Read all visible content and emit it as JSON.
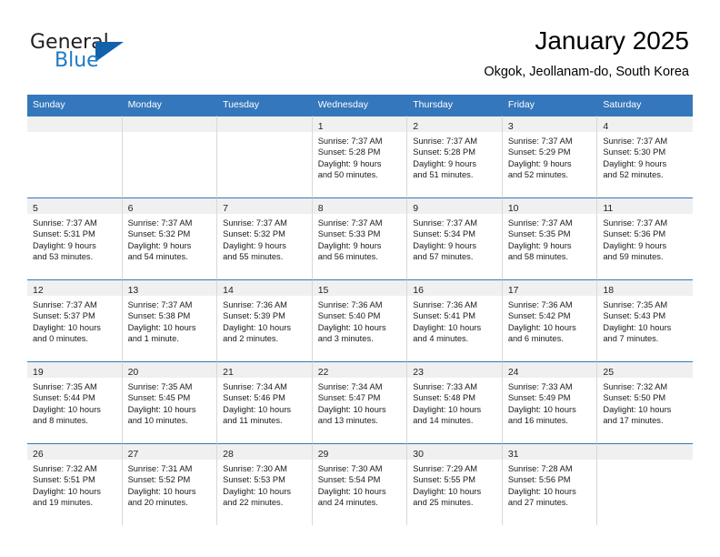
{
  "brand": {
    "word1": "General",
    "word2": "Blue",
    "triangle_color": "#1162ab",
    "blue_color": "#1f7ac4"
  },
  "header": {
    "month_title": "January 2025",
    "location": "Okgok, Jeollanam-do, South Korea"
  },
  "theme": {
    "header_bg": "#3577bc",
    "daynum_bg": "#f0f0f0",
    "cell_border": "#d8d8d8"
  },
  "weekdays": [
    "Sunday",
    "Monday",
    "Tuesday",
    "Wednesday",
    "Thursday",
    "Friday",
    "Saturday"
  ],
  "weeks": [
    [
      {
        "day": "",
        "lines": []
      },
      {
        "day": "",
        "lines": []
      },
      {
        "day": "",
        "lines": []
      },
      {
        "day": "1",
        "lines": [
          "Sunrise: 7:37 AM",
          "Sunset: 5:28 PM",
          "Daylight: 9 hours",
          "and 50 minutes."
        ]
      },
      {
        "day": "2",
        "lines": [
          "Sunrise: 7:37 AM",
          "Sunset: 5:28 PM",
          "Daylight: 9 hours",
          "and 51 minutes."
        ]
      },
      {
        "day": "3",
        "lines": [
          "Sunrise: 7:37 AM",
          "Sunset: 5:29 PM",
          "Daylight: 9 hours",
          "and 52 minutes."
        ]
      },
      {
        "day": "4",
        "lines": [
          "Sunrise: 7:37 AM",
          "Sunset: 5:30 PM",
          "Daylight: 9 hours",
          "and 52 minutes."
        ]
      }
    ],
    [
      {
        "day": "5",
        "lines": [
          "Sunrise: 7:37 AM",
          "Sunset: 5:31 PM",
          "Daylight: 9 hours",
          "and 53 minutes."
        ]
      },
      {
        "day": "6",
        "lines": [
          "Sunrise: 7:37 AM",
          "Sunset: 5:32 PM",
          "Daylight: 9 hours",
          "and 54 minutes."
        ]
      },
      {
        "day": "7",
        "lines": [
          "Sunrise: 7:37 AM",
          "Sunset: 5:32 PM",
          "Daylight: 9 hours",
          "and 55 minutes."
        ]
      },
      {
        "day": "8",
        "lines": [
          "Sunrise: 7:37 AM",
          "Sunset: 5:33 PM",
          "Daylight: 9 hours",
          "and 56 minutes."
        ]
      },
      {
        "day": "9",
        "lines": [
          "Sunrise: 7:37 AM",
          "Sunset: 5:34 PM",
          "Daylight: 9 hours",
          "and 57 minutes."
        ]
      },
      {
        "day": "10",
        "lines": [
          "Sunrise: 7:37 AM",
          "Sunset: 5:35 PM",
          "Daylight: 9 hours",
          "and 58 minutes."
        ]
      },
      {
        "day": "11",
        "lines": [
          "Sunrise: 7:37 AM",
          "Sunset: 5:36 PM",
          "Daylight: 9 hours",
          "and 59 minutes."
        ]
      }
    ],
    [
      {
        "day": "12",
        "lines": [
          "Sunrise: 7:37 AM",
          "Sunset: 5:37 PM",
          "Daylight: 10 hours",
          "and 0 minutes."
        ]
      },
      {
        "day": "13",
        "lines": [
          "Sunrise: 7:37 AM",
          "Sunset: 5:38 PM",
          "Daylight: 10 hours",
          "and 1 minute."
        ]
      },
      {
        "day": "14",
        "lines": [
          "Sunrise: 7:36 AM",
          "Sunset: 5:39 PM",
          "Daylight: 10 hours",
          "and 2 minutes."
        ]
      },
      {
        "day": "15",
        "lines": [
          "Sunrise: 7:36 AM",
          "Sunset: 5:40 PM",
          "Daylight: 10 hours",
          "and 3 minutes."
        ]
      },
      {
        "day": "16",
        "lines": [
          "Sunrise: 7:36 AM",
          "Sunset: 5:41 PM",
          "Daylight: 10 hours",
          "and 4 minutes."
        ]
      },
      {
        "day": "17",
        "lines": [
          "Sunrise: 7:36 AM",
          "Sunset: 5:42 PM",
          "Daylight: 10 hours",
          "and 6 minutes."
        ]
      },
      {
        "day": "18",
        "lines": [
          "Sunrise: 7:35 AM",
          "Sunset: 5:43 PM",
          "Daylight: 10 hours",
          "and 7 minutes."
        ]
      }
    ],
    [
      {
        "day": "19",
        "lines": [
          "Sunrise: 7:35 AM",
          "Sunset: 5:44 PM",
          "Daylight: 10 hours",
          "and 8 minutes."
        ]
      },
      {
        "day": "20",
        "lines": [
          "Sunrise: 7:35 AM",
          "Sunset: 5:45 PM",
          "Daylight: 10 hours",
          "and 10 minutes."
        ]
      },
      {
        "day": "21",
        "lines": [
          "Sunrise: 7:34 AM",
          "Sunset: 5:46 PM",
          "Daylight: 10 hours",
          "and 11 minutes."
        ]
      },
      {
        "day": "22",
        "lines": [
          "Sunrise: 7:34 AM",
          "Sunset: 5:47 PM",
          "Daylight: 10 hours",
          "and 13 minutes."
        ]
      },
      {
        "day": "23",
        "lines": [
          "Sunrise: 7:33 AM",
          "Sunset: 5:48 PM",
          "Daylight: 10 hours",
          "and 14 minutes."
        ]
      },
      {
        "day": "24",
        "lines": [
          "Sunrise: 7:33 AM",
          "Sunset: 5:49 PM",
          "Daylight: 10 hours",
          "and 16 minutes."
        ]
      },
      {
        "day": "25",
        "lines": [
          "Sunrise: 7:32 AM",
          "Sunset: 5:50 PM",
          "Daylight: 10 hours",
          "and 17 minutes."
        ]
      }
    ],
    [
      {
        "day": "26",
        "lines": [
          "Sunrise: 7:32 AM",
          "Sunset: 5:51 PM",
          "Daylight: 10 hours",
          "and 19 minutes."
        ]
      },
      {
        "day": "27",
        "lines": [
          "Sunrise: 7:31 AM",
          "Sunset: 5:52 PM",
          "Daylight: 10 hours",
          "and 20 minutes."
        ]
      },
      {
        "day": "28",
        "lines": [
          "Sunrise: 7:30 AM",
          "Sunset: 5:53 PM",
          "Daylight: 10 hours",
          "and 22 minutes."
        ]
      },
      {
        "day": "29",
        "lines": [
          "Sunrise: 7:30 AM",
          "Sunset: 5:54 PM",
          "Daylight: 10 hours",
          "and 24 minutes."
        ]
      },
      {
        "day": "30",
        "lines": [
          "Sunrise: 7:29 AM",
          "Sunset: 5:55 PM",
          "Daylight: 10 hours",
          "and 25 minutes."
        ]
      },
      {
        "day": "31",
        "lines": [
          "Sunrise: 7:28 AM",
          "Sunset: 5:56 PM",
          "Daylight: 10 hours",
          "and 27 minutes."
        ]
      },
      {
        "day": "",
        "lines": []
      }
    ]
  ]
}
